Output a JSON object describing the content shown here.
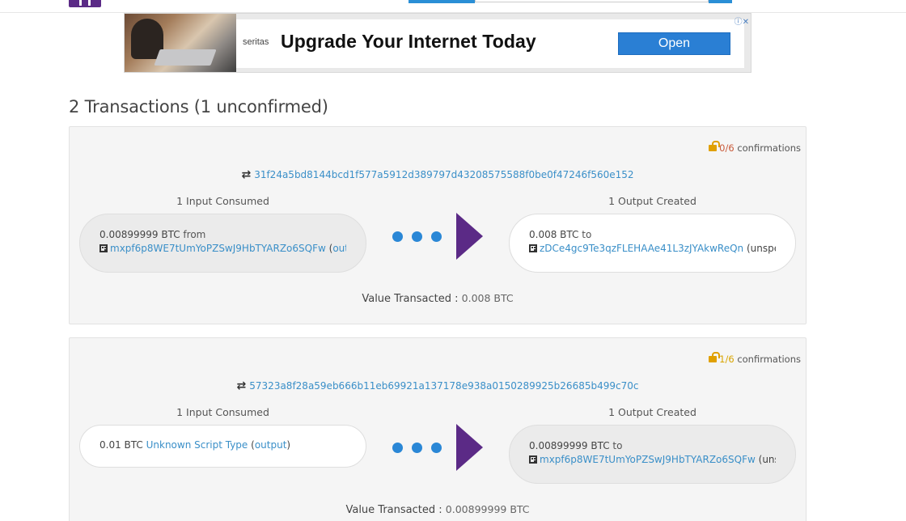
{
  "ad": {
    "brand": "seritas",
    "headline": "Upgrade Your Internet Today",
    "cta": "Open",
    "choices": "ⓘ✕"
  },
  "page_title": "2 Transactions (1 unconfirmed)",
  "transactions": [
    {
      "confirmations_count": "0/6",
      "confirmations_label": "confirmations",
      "hash": "31f24a5bd8144bcd1f577a5912d389797d43208575588f0be0f47246f560e152",
      "inputs_title": "1 Input Consumed",
      "outputs_title": "1 Output Created",
      "input": {
        "amount": "0.00899999 BTC",
        "from_label": "from",
        "address": "mxpf6p8WE7tUmYoPZSwJ9HbTYARZo6SQFw",
        "link_text": "out…"
      },
      "output": {
        "amount": "0.008 BTC",
        "to_label": "to",
        "address": "zDCe4gc9Te3qzFLEHAAe41L3zJYAkwReQn",
        "status": "(unspent)"
      },
      "value_label": "Value Transacted",
      "value_sep": ":",
      "value": "0.008 BTC"
    },
    {
      "confirmations_count": "1/6",
      "confirmations_label": "confirmations",
      "hash": "57323a8f28a59eb666b11eb69921a137178e938a0150289925b26685b499c70c",
      "inputs_title": "1 Input Consumed",
      "outputs_title": "1 Output Created",
      "input": {
        "amount": "0.01 BTC",
        "script_type": "Unknown Script Type",
        "link_open": "(",
        "link_text": "output",
        "link_close": ")"
      },
      "output": {
        "amount": "0.00899999 BTC",
        "to_label": "to",
        "address": "mxpf6p8WE7tUmYoPZSwJ9HbTYARZo6SQFw",
        "status": "(uns…"
      },
      "value_label": "Value Transacted",
      "value_sep": ":",
      "value": "0.00899999 BTC"
    }
  ]
}
